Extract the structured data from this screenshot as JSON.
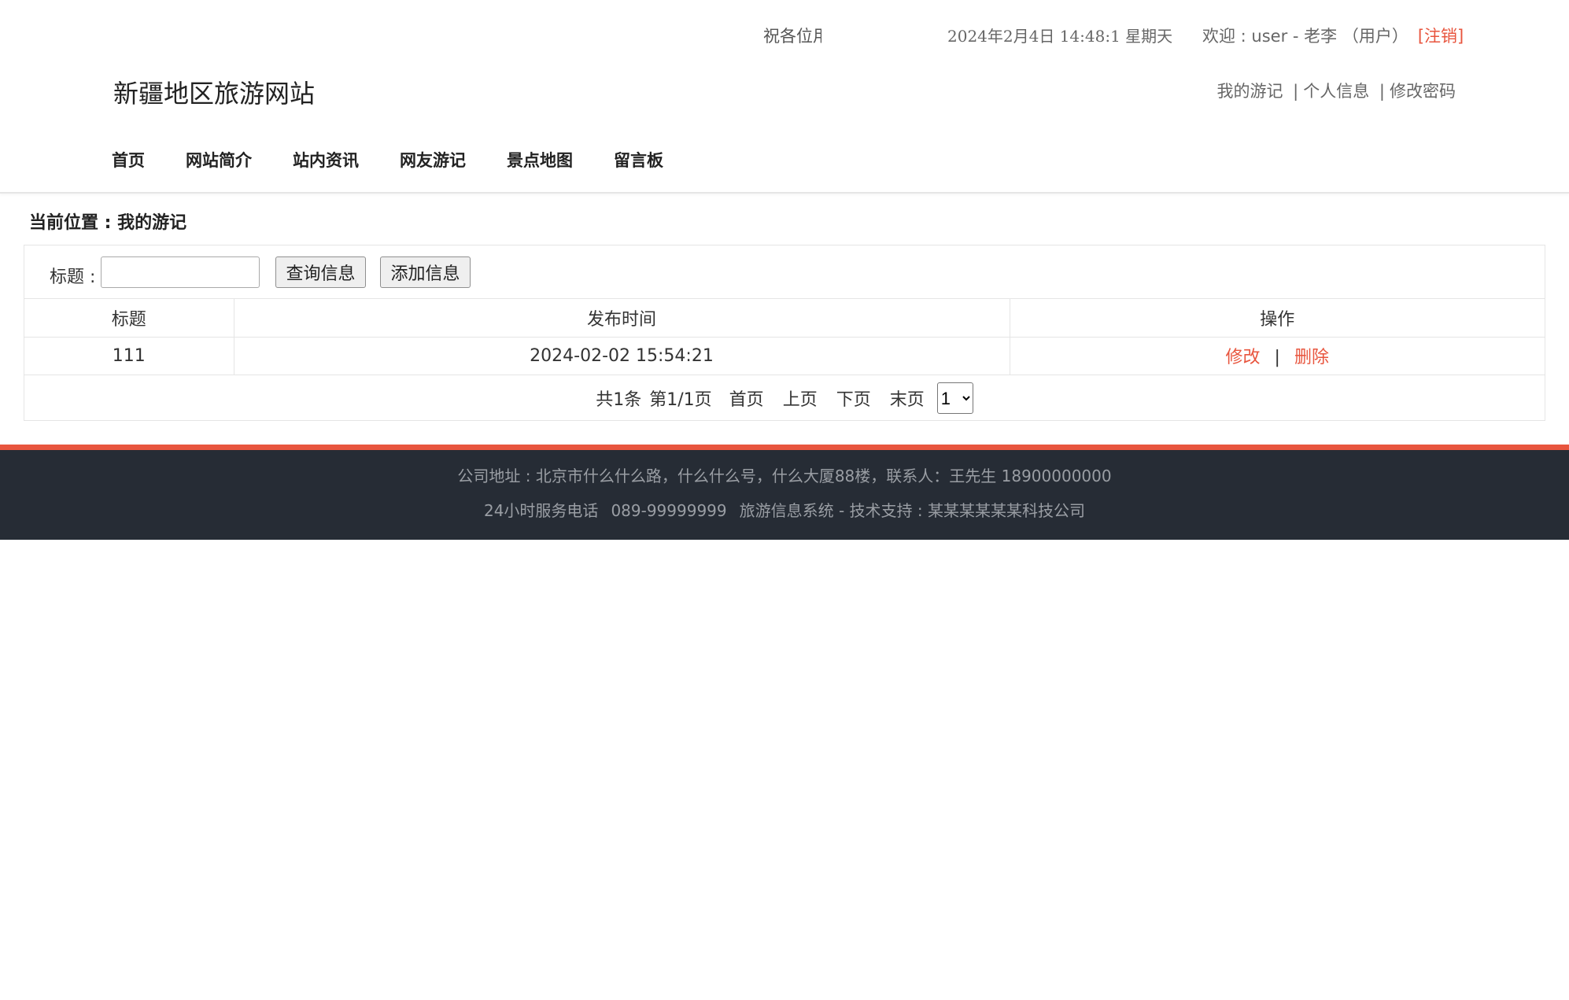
{
  "header": {
    "marquee_text": "祝各位用户旅途愉快",
    "datetime": "2024年2月4日 14:48:1 星期天",
    "welcome_text": "欢迎 : user - 老李 （用户）",
    "logout_label": "[注销]",
    "site_title": "新疆地区旅游网站",
    "user_links": {
      "my_travelogue": "我的游记",
      "separator1": "|",
      "profile": "个人信息",
      "separator2": "|",
      "change_password": "修改密码"
    },
    "nav": [
      "首页",
      "网站简介",
      "站内资讯",
      "网友游记",
      "景点地图",
      "留言板"
    ]
  },
  "breadcrumb": "当前位置 : 我的游记",
  "search": {
    "label": "标题 :",
    "value": "",
    "placeholder": "",
    "query_button": "查询信息",
    "add_button": "添加信息"
  },
  "table": {
    "columns": [
      "标题",
      "发布时间",
      "操作"
    ],
    "rows": [
      {
        "title": "111",
        "published": "2024-02-02 15:54:21",
        "edit_label": "修改",
        "separator": "|",
        "delete_label": "删除"
      }
    ]
  },
  "pager": {
    "total": "共1条",
    "page_info": "第1/1页",
    "first": "首页",
    "prev": "上页",
    "next": "下页",
    "last": "末页",
    "selected_page": "1"
  },
  "footer": {
    "address": "公司地址 : 北京市什么什么路，什么什么号，什么大厦88楼，联系人：王先生 18900000000",
    "service_hotline_label": "24小时服务电话",
    "service_hotline": "089-99999999",
    "system_credit": "旅游信息系统 - 技术支持 : 某某某某某某科技公司"
  },
  "colors": {
    "accent": "#e8553e",
    "footer_bg": "#262c35",
    "footer_text": "#9a9ea4"
  }
}
